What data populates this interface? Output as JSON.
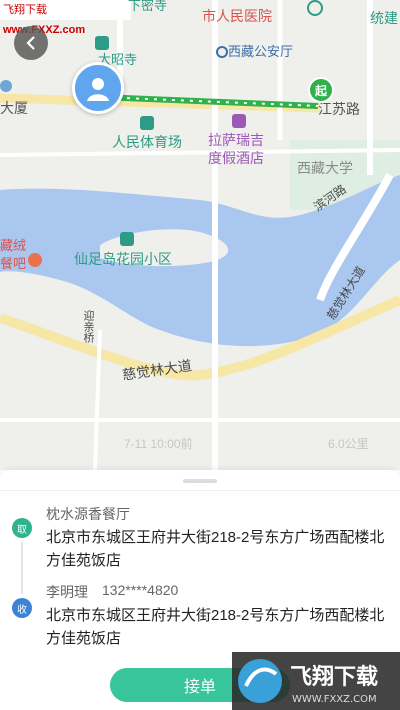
{
  "watermark_top": {
    "brand": "飞翔下载",
    "url": "www.FXXZ.com"
  },
  "map": {
    "labels": {
      "xiamisi": "下密寺",
      "hospital": "市人民医院",
      "tongjian": "统建",
      "dazhaosi": "大昭寺",
      "gonganting": "西藏公安厅",
      "dasha": "大厦",
      "jiangsulu": "江苏路",
      "stadium": "人民体育场",
      "hotel_line1": "拉萨瑞吉",
      "hotel_line2": "度假酒店",
      "xizang_univ": "西藏大学",
      "binhelu": "滨河路",
      "restaurant_line1": "藏绒",
      "restaurant_line2": "餐吧",
      "xianzudao": "仙足岛花园小区",
      "yingqinqiao": "迎亲桥",
      "ciqiu_avenue": "慈觉林大道",
      "ciqiu_avenue_vertical": "慈觉林大道",
      "faint_time": "7-11 10:00前",
      "faint_distance": "6.0公里"
    },
    "start_marker": "起",
    "colors": {
      "water": "#a9c7ef",
      "road_major": "#f6e7a7",
      "route": "#2fb14c"
    }
  },
  "order": {
    "take_badge": "取",
    "pickup_name": "枕水源香餐厅",
    "pickup_address": "北京市东城区王府井大街218-2号东方广场西配楼北方佳苑饭店",
    "recv_badge": "收",
    "receiver_name": "李明理",
    "receiver_phone": "132****4820",
    "receiver_address": "北京市东城区王府井大街218-2号东方广场西配楼北方佳苑饭店",
    "accept_label": "接单"
  },
  "watermark_bottom": {
    "brand": "飞翔下载",
    "url": "WWW.FXXZ.COM"
  }
}
